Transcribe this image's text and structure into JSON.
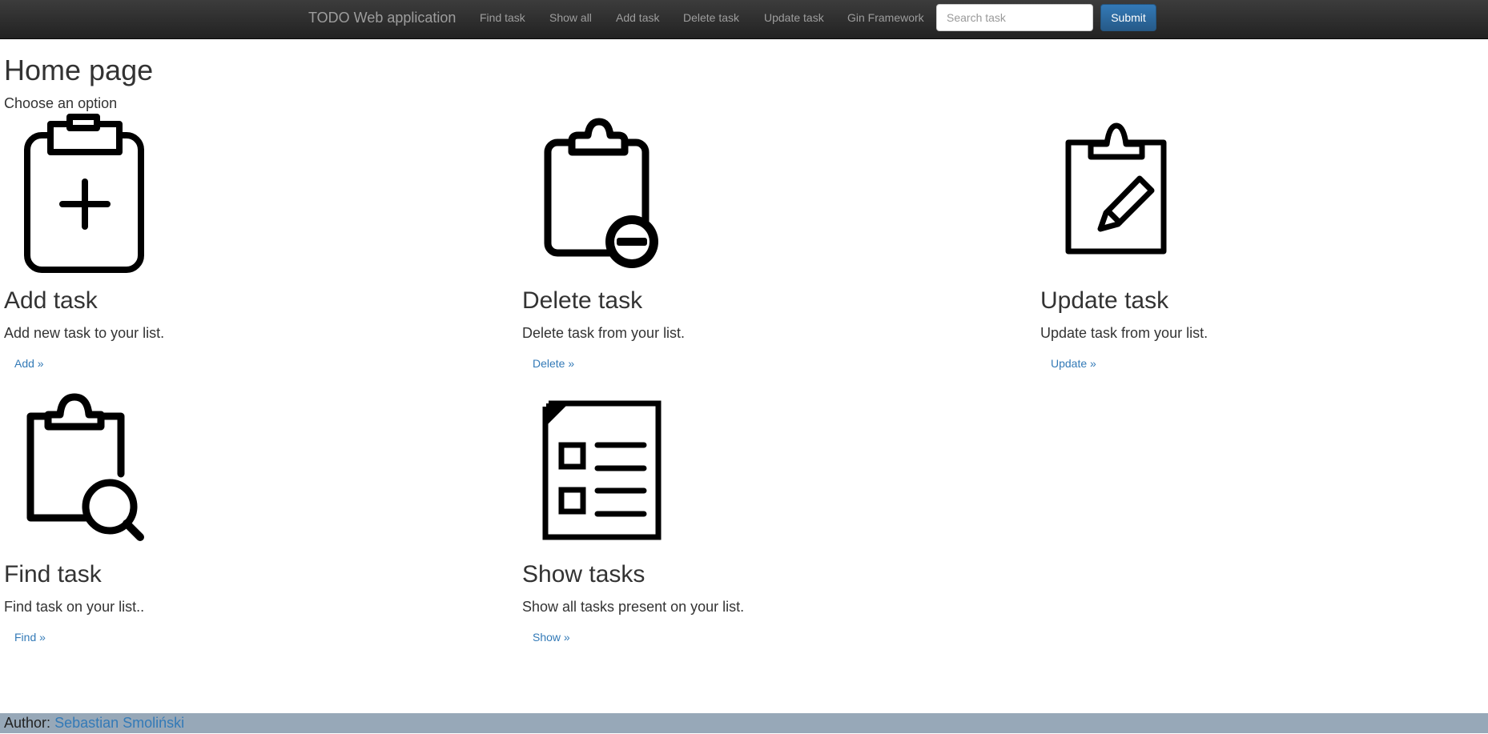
{
  "navbar": {
    "brand": "TODO Web application",
    "links": [
      "Find task",
      "Show all",
      "Add task",
      "Delete task",
      "Update task",
      "Gin Framework"
    ],
    "search_placeholder": "Search task",
    "submit_label": "Submit"
  },
  "main": {
    "title": "Home page",
    "subtitle": "Choose an option",
    "cards": [
      {
        "heading": "Add task",
        "description": "Add new task to your list.",
        "link": "Add »",
        "icon": "clipboard-plus-icon"
      },
      {
        "heading": "Delete task",
        "description": "Delete task from your list.",
        "link": "Delete »",
        "icon": "clipboard-minus-icon"
      },
      {
        "heading": "Update task",
        "description": "Update task from your list.",
        "link": "Update »",
        "icon": "clipboard-pencil-icon"
      },
      {
        "heading": "Find task",
        "description": "Find task on your list..",
        "link": "Find »",
        "icon": "clipboard-search-icon"
      },
      {
        "heading": "Show tasks",
        "description": "Show all tasks present on your list.",
        "link": "Show »",
        "icon": "document-list-icon"
      }
    ]
  },
  "footer": {
    "label": "Author:",
    "author": "Sebastian Smoliński"
  },
  "colors": {
    "navbar_bg": "#222222",
    "link": "#337ab7",
    "button": "#337ab7",
    "footer_bg": "#97a8b8"
  }
}
